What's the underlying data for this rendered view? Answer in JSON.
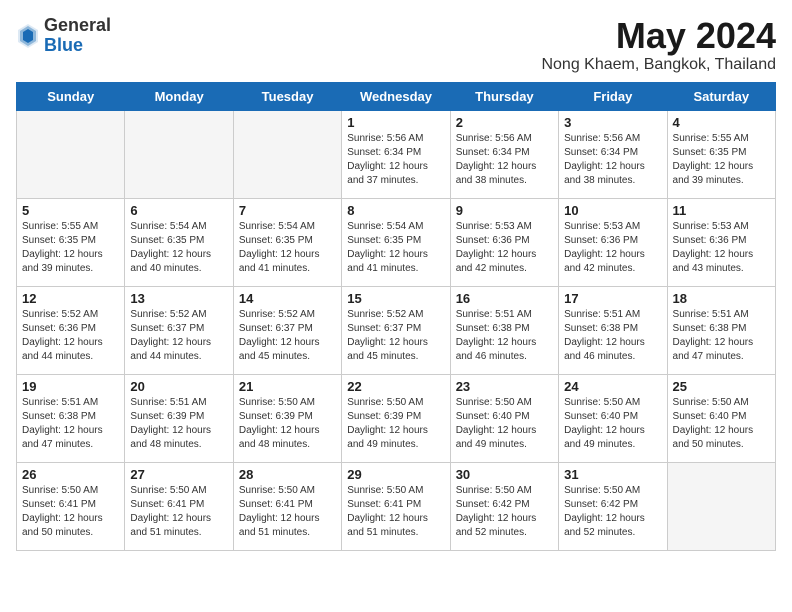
{
  "header": {
    "logo_general": "General",
    "logo_blue": "Blue",
    "month_title": "May 2024",
    "location": "Nong Khaem, Bangkok, Thailand"
  },
  "weekdays": [
    "Sunday",
    "Monday",
    "Tuesday",
    "Wednesday",
    "Thursday",
    "Friday",
    "Saturday"
  ],
  "weeks": [
    [
      {
        "num": "",
        "info": ""
      },
      {
        "num": "",
        "info": ""
      },
      {
        "num": "",
        "info": ""
      },
      {
        "num": "1",
        "info": "Sunrise: 5:56 AM\nSunset: 6:34 PM\nDaylight: 12 hours\nand 37 minutes."
      },
      {
        "num": "2",
        "info": "Sunrise: 5:56 AM\nSunset: 6:34 PM\nDaylight: 12 hours\nand 38 minutes."
      },
      {
        "num": "3",
        "info": "Sunrise: 5:56 AM\nSunset: 6:34 PM\nDaylight: 12 hours\nand 38 minutes."
      },
      {
        "num": "4",
        "info": "Sunrise: 5:55 AM\nSunset: 6:35 PM\nDaylight: 12 hours\nand 39 minutes."
      }
    ],
    [
      {
        "num": "5",
        "info": "Sunrise: 5:55 AM\nSunset: 6:35 PM\nDaylight: 12 hours\nand 39 minutes."
      },
      {
        "num": "6",
        "info": "Sunrise: 5:54 AM\nSunset: 6:35 PM\nDaylight: 12 hours\nand 40 minutes."
      },
      {
        "num": "7",
        "info": "Sunrise: 5:54 AM\nSunset: 6:35 PM\nDaylight: 12 hours\nand 41 minutes."
      },
      {
        "num": "8",
        "info": "Sunrise: 5:54 AM\nSunset: 6:35 PM\nDaylight: 12 hours\nand 41 minutes."
      },
      {
        "num": "9",
        "info": "Sunrise: 5:53 AM\nSunset: 6:36 PM\nDaylight: 12 hours\nand 42 minutes."
      },
      {
        "num": "10",
        "info": "Sunrise: 5:53 AM\nSunset: 6:36 PM\nDaylight: 12 hours\nand 42 minutes."
      },
      {
        "num": "11",
        "info": "Sunrise: 5:53 AM\nSunset: 6:36 PM\nDaylight: 12 hours\nand 43 minutes."
      }
    ],
    [
      {
        "num": "12",
        "info": "Sunrise: 5:52 AM\nSunset: 6:36 PM\nDaylight: 12 hours\nand 44 minutes."
      },
      {
        "num": "13",
        "info": "Sunrise: 5:52 AM\nSunset: 6:37 PM\nDaylight: 12 hours\nand 44 minutes."
      },
      {
        "num": "14",
        "info": "Sunrise: 5:52 AM\nSunset: 6:37 PM\nDaylight: 12 hours\nand 45 minutes."
      },
      {
        "num": "15",
        "info": "Sunrise: 5:52 AM\nSunset: 6:37 PM\nDaylight: 12 hours\nand 45 minutes."
      },
      {
        "num": "16",
        "info": "Sunrise: 5:51 AM\nSunset: 6:38 PM\nDaylight: 12 hours\nand 46 minutes."
      },
      {
        "num": "17",
        "info": "Sunrise: 5:51 AM\nSunset: 6:38 PM\nDaylight: 12 hours\nand 46 minutes."
      },
      {
        "num": "18",
        "info": "Sunrise: 5:51 AM\nSunset: 6:38 PM\nDaylight: 12 hours\nand 47 minutes."
      }
    ],
    [
      {
        "num": "19",
        "info": "Sunrise: 5:51 AM\nSunset: 6:38 PM\nDaylight: 12 hours\nand 47 minutes."
      },
      {
        "num": "20",
        "info": "Sunrise: 5:51 AM\nSunset: 6:39 PM\nDaylight: 12 hours\nand 48 minutes."
      },
      {
        "num": "21",
        "info": "Sunrise: 5:50 AM\nSunset: 6:39 PM\nDaylight: 12 hours\nand 48 minutes."
      },
      {
        "num": "22",
        "info": "Sunrise: 5:50 AM\nSunset: 6:39 PM\nDaylight: 12 hours\nand 49 minutes."
      },
      {
        "num": "23",
        "info": "Sunrise: 5:50 AM\nSunset: 6:40 PM\nDaylight: 12 hours\nand 49 minutes."
      },
      {
        "num": "24",
        "info": "Sunrise: 5:50 AM\nSunset: 6:40 PM\nDaylight: 12 hours\nand 49 minutes."
      },
      {
        "num": "25",
        "info": "Sunrise: 5:50 AM\nSunset: 6:40 PM\nDaylight: 12 hours\nand 50 minutes."
      }
    ],
    [
      {
        "num": "26",
        "info": "Sunrise: 5:50 AM\nSunset: 6:41 PM\nDaylight: 12 hours\nand 50 minutes."
      },
      {
        "num": "27",
        "info": "Sunrise: 5:50 AM\nSunset: 6:41 PM\nDaylight: 12 hours\nand 51 minutes."
      },
      {
        "num": "28",
        "info": "Sunrise: 5:50 AM\nSunset: 6:41 PM\nDaylight: 12 hours\nand 51 minutes."
      },
      {
        "num": "29",
        "info": "Sunrise: 5:50 AM\nSunset: 6:41 PM\nDaylight: 12 hours\nand 51 minutes."
      },
      {
        "num": "30",
        "info": "Sunrise: 5:50 AM\nSunset: 6:42 PM\nDaylight: 12 hours\nand 52 minutes."
      },
      {
        "num": "31",
        "info": "Sunrise: 5:50 AM\nSunset: 6:42 PM\nDaylight: 12 hours\nand 52 minutes."
      },
      {
        "num": "",
        "info": ""
      }
    ]
  ]
}
